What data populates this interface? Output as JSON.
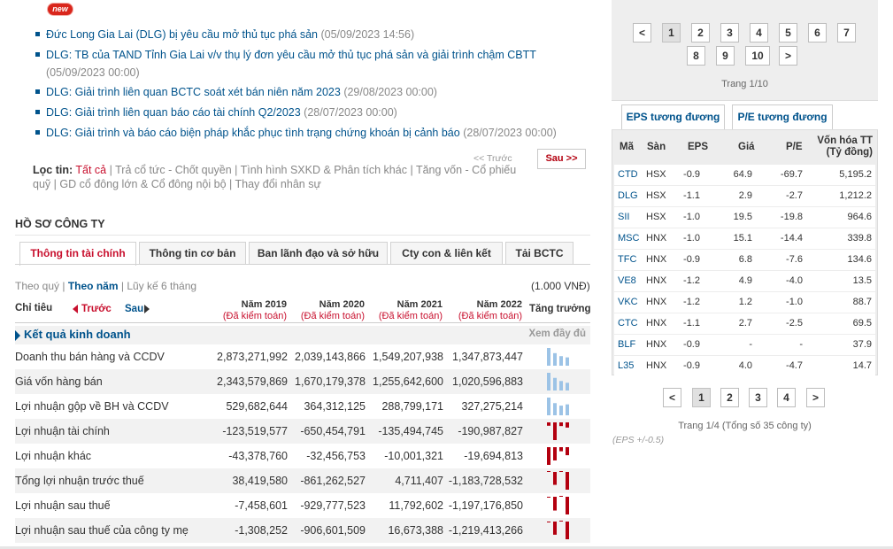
{
  "news": {
    "badge": "new",
    "items": [
      {
        "title": "Đức Long Gia Lai (DLG) bị yêu cầu mở thủ tục phá sản",
        "date": "(05/09/2023 14:56)"
      },
      {
        "title": "DLG: TB của TAND Tỉnh Gia Lai v/v thụ lý đơn yêu cầu mở thủ tục phá sản và giải trình chậm CBTT",
        "date": "(05/09/2023 00:00)"
      },
      {
        "title": "DLG: Giải trình liên quan BCTC soát xét bán niên năm 2023",
        "date": "(29/08/2023 00:00)"
      },
      {
        "title": "DLG: Giải trình liên quan báo cáo tài chính Q2/2023",
        "date": "(28/07/2023 00:00)"
      },
      {
        "title": "DLG: Giải trình và báo cáo biện pháp khắc phục tình trạng chứng khoán bị cảnh báo",
        "date": "(28/07/2023 00:00)"
      }
    ],
    "prev_label": "<< Trước",
    "next_label": "Sau >>",
    "filter": {
      "label": "Lọc tin:",
      "active": "Tất cả",
      "options": [
        "Trả cổ tức - Chốt quyền",
        "Tình hình SXKD & Phân tích khác",
        "Tăng vốn - Cổ phiếu quỹ",
        "GD cổ đông lớn & Cổ đông nội bộ",
        "Thay đổi nhân sự"
      ]
    }
  },
  "profile": {
    "title": "HỒ SƠ CÔNG TY",
    "tabs": [
      "Thông tin tài chính",
      "Thông tin cơ bản",
      "Ban lãnh đạo và sở hữu",
      "Cty con & liên kết",
      "Tải BCTC"
    ],
    "period": {
      "quarter": "Theo quý",
      "year": "Theo năm",
      "ttm": "Lũy kế 6 tháng"
    },
    "unit": "(1.000 VNĐ)",
    "header": {
      "chitieu": "Chỉ tiêu",
      "truoc": "Trước",
      "sau": "Sau",
      "growth": "Tăng trưởng",
      "years": [
        {
          "y": "Năm 2019",
          "a": "(Đã kiểm toán)"
        },
        {
          "y": "Năm 2020",
          "a": "(Đã kiểm toán)"
        },
        {
          "y": "Năm 2021",
          "a": "(Đã kiểm toán)"
        },
        {
          "y": "Năm 2022",
          "a": "(Đã kiểm toán)"
        }
      ]
    },
    "section": {
      "title": "Kết quả kinh doanh",
      "more": "Xem đầy đủ"
    },
    "rows": [
      {
        "name": "Doanh thu bán hàng và CCDV",
        "values": [
          "2,873,271,992",
          "2,039,143,866",
          "1,549,207,938",
          "1,347,873,447"
        ],
        "nums": [
          2873271992,
          2039143866,
          1549207938,
          1347873447
        ]
      },
      {
        "name": "Giá vốn hàng bán",
        "values": [
          "2,343,579,869",
          "1,670,179,378",
          "1,255,642,600",
          "1,020,596,883"
        ],
        "nums": [
          2343579869,
          1670179378,
          1255642600,
          1020596883
        ]
      },
      {
        "name": "Lợi nhuận gộp về BH và CCDV",
        "values": [
          "529,682,644",
          "364,312,125",
          "288,799,171",
          "327,275,214"
        ],
        "nums": [
          529682644,
          364312125,
          288799171,
          327275214
        ]
      },
      {
        "name": "Lợi nhuận tài chính",
        "values": [
          "-123,519,577",
          "-650,454,791",
          "-135,494,745",
          "-190,987,827"
        ],
        "nums": [
          -123519577,
          -650454791,
          -135494745,
          -190987827
        ]
      },
      {
        "name": "Lợi nhuận khác",
        "values": [
          "-43,378,760",
          "-32,456,753",
          "-10,001,321",
          "-19,694,813"
        ],
        "nums": [
          -43378760,
          -32456753,
          -10001321,
          -19694813
        ]
      },
      {
        "name": "Tổng lợi nhuận trước thuế",
        "values": [
          "38,419,580",
          "-861,262,527",
          "4,711,407",
          "-1,183,728,532"
        ],
        "nums": [
          38419580,
          -861262527,
          4711407,
          -1183728532
        ]
      },
      {
        "name": "Lợi nhuận sau thuế",
        "values": [
          "-7,458,601",
          "-929,777,523",
          "11,792,602",
          "-1,197,176,850"
        ],
        "nums": [
          -7458601,
          -929777523,
          11792602,
          -1197176850
        ]
      },
      {
        "name": "Lợi nhuận sau thuế của công ty mẹ",
        "values": [
          "-1,308,252",
          "-906,601,509",
          "16,673,388",
          "-1,219,413,266"
        ],
        "nums": [
          -1308252,
          -906601509,
          16673388,
          -1219413266
        ]
      }
    ],
    "colors": {
      "positive": "#9cc3e6",
      "negative": "#b3000f"
    }
  },
  "right": {
    "top_pages": [
      "<",
      "1",
      "2",
      "3",
      "4",
      "5",
      "6",
      "7",
      "8",
      "9",
      "10",
      ">"
    ],
    "top_page_info": "Trang 1/10",
    "tabs": [
      "EPS tương đương",
      "P/E tương đương"
    ],
    "table": {
      "headers": [
        "Mã",
        "Sàn",
        "EPS",
        "Giá",
        "P/E",
        "Vốn hóa TT (Tỷ đồng)"
      ],
      "rows": [
        [
          "CTD",
          "HSX",
          "-0.9",
          "64.9",
          "-69.7",
          "5,195.2"
        ],
        [
          "DLG",
          "HSX",
          "-1.1",
          "2.9",
          "-2.7",
          "1,212.2"
        ],
        [
          "SII",
          "HSX",
          "-1.0",
          "19.5",
          "-19.8",
          "964.6"
        ],
        [
          "MSC",
          "HNX",
          "-1.0",
          "15.1",
          "-14.4",
          "339.8"
        ],
        [
          "TFC",
          "HNX",
          "-0.9",
          "6.8",
          "-7.6",
          "134.6"
        ],
        [
          "VE8",
          "HNX",
          "-1.2",
          "4.9",
          "-4.0",
          "13.5"
        ],
        [
          "VKC",
          "HNX",
          "-1.2",
          "1.2",
          "-1.0",
          "88.7"
        ],
        [
          "CTC",
          "HNX",
          "-1.1",
          "2.7",
          "-2.5",
          "69.5"
        ],
        [
          "BLF",
          "HNX",
          "-0.9",
          "-",
          "-",
          "37.9"
        ],
        [
          "L35",
          "HNX",
          "-0.9",
          "4.0",
          "-4.7",
          "14.7"
        ]
      ]
    },
    "bottom_pages": [
      "<",
      "1",
      "2",
      "3",
      "4",
      ">"
    ],
    "bottom_page_info": "Trang 1/4 (Tổng số 35 công ty)",
    "note": "(EPS +/-0.5)"
  }
}
